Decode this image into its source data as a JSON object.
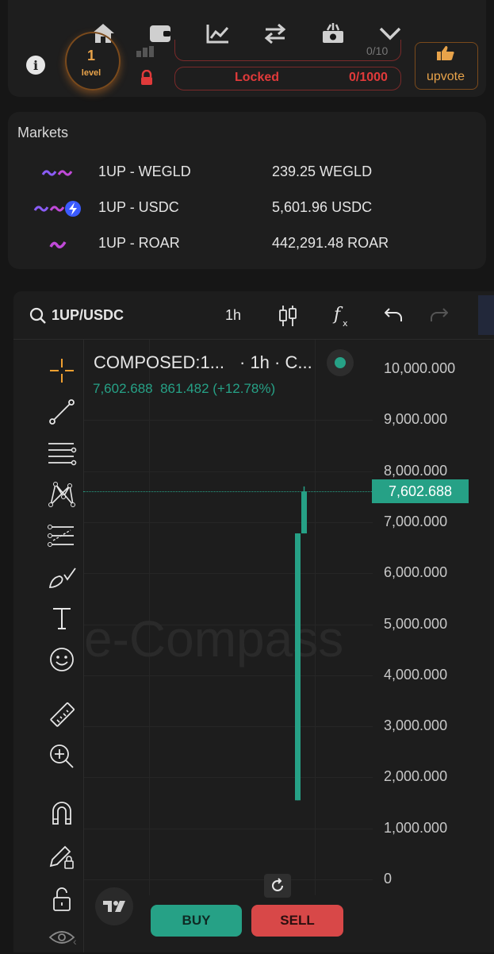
{
  "nav": {
    "icons": [
      "home-icon",
      "wallet-icon",
      "chart-icon",
      "swap-icon",
      "money-icon",
      "chevron-down-icon"
    ]
  },
  "profile": {
    "level_number": "1",
    "level_label": "level",
    "top_counter": "0/10",
    "locked_label": "Locked",
    "locked_counter": "0/1000",
    "upvote_label": "upvote"
  },
  "markets": {
    "title": "Markets",
    "rows": [
      {
        "pair": "1UP - WEGLD",
        "value": "239.25 WEGLD"
      },
      {
        "pair": "1UP - USDC",
        "value": "5,601.96 USDC"
      },
      {
        "pair": "1UP - ROAR",
        "value": "442,291.48 ROAR"
      }
    ]
  },
  "chart": {
    "symbol": "1UP/USDC",
    "interval": "1h",
    "legend_title": "COMPOSED:1...",
    "legend_meta": "· 1h · C...",
    "ohlc_line": "7,602.688  861.482 (+12.78%)",
    "price_tag": "7,602.688",
    "watermark": "e-Compass",
    "accent_up": "#26a186",
    "accent_down": "#e04a4a"
  },
  "chart_data": {
    "type": "candlestick",
    "y_ticks": [
      "10,000.000",
      "9,000.000",
      "8,000.000",
      "7,000.000",
      "6,000.000",
      "5,000.000",
      "4,000.000",
      "3,000.000",
      "2,000.000",
      "1,000.000",
      "0"
    ],
    "ylim": [
      0,
      10000
    ],
    "candles": [
      {
        "open": 1550,
        "close": 6780,
        "high": 6780,
        "low": 1550
      },
      {
        "open": 6780,
        "close": 7602.688,
        "high": 7700,
        "low": 6780
      }
    ],
    "last_price": 7602.688
  },
  "actions": {
    "buy_label": "BUY",
    "sell_label": "SELL"
  }
}
